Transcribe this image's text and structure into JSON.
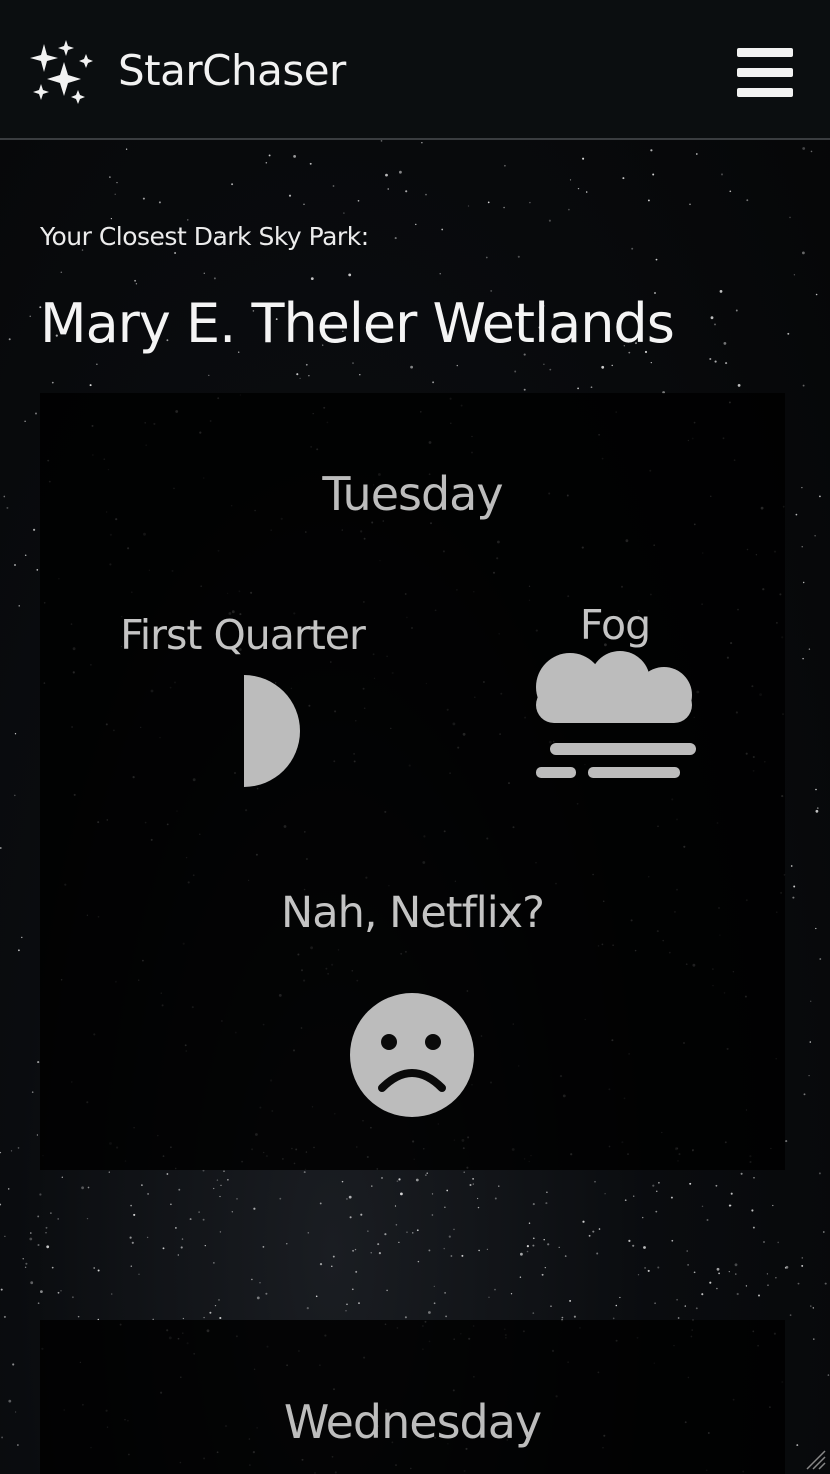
{
  "app": {
    "brand": "StarChaser",
    "logo_icon": "sparkles-icon",
    "menu_icon": "hamburger-menu-icon"
  },
  "park": {
    "label": "Your Closest Dark Sky Park:",
    "name": "Mary E. Theler Wetlands"
  },
  "forecast": [
    {
      "day": "Tuesday",
      "moon_phase": "First Quarter",
      "moon_icon": "first-quarter-moon-icon",
      "weather": "Fog",
      "weather_icon": "fog-icon",
      "verdict": "Nah, Netflix?",
      "verdict_icon": "sad-face-icon"
    },
    {
      "day": "Wednesday"
    }
  ],
  "colors": {
    "background": "#07090b",
    "topbar": "#0b0e10",
    "text_primary": "#f2f2f2",
    "text_muted": "#c4c4c4",
    "icon_fill": "#bcbcbc",
    "card": "#000000"
  }
}
